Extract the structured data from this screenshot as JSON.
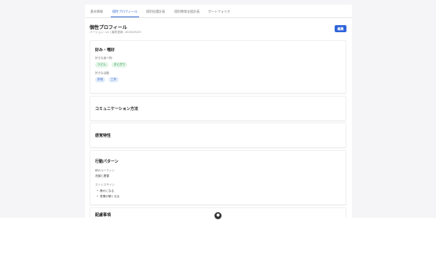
{
  "tabs": [
    {
      "label": "基本情報"
    },
    {
      "label": "個性プロフィール"
    },
    {
      "label": "個別処遇計画"
    },
    {
      "label": "個別教育支援計画"
    },
    {
      "label": "ポートフォリオ"
    }
  ],
  "page": {
    "title": "個性プロフィール",
    "subtitle": "バージョン: v2 | 最終更新: 2025/05/25",
    "edit_label": "編集"
  },
  "sections": {
    "likes": {
      "title": "好み・嗜好",
      "food_label": "好きな食べ物",
      "foods": [
        "うどん",
        "おにぎり"
      ],
      "activity_label": "好きな活動",
      "activities": [
        "折紙",
        "工作"
      ]
    },
    "communication": {
      "title": "コミュニケーション方法"
    },
    "sensory": {
      "title": "感覚特性"
    },
    "behavior": {
      "title": "行動パターン",
      "routine_label": "朝のルーティン",
      "routine_value": "洗顔と着替",
      "stress_label": "ストレスサイン",
      "stress_items": [
        "静かになる",
        "表情が硬くなる"
      ]
    },
    "notes": {
      "title": "配慮事項"
    }
  },
  "colors": {
    "accent": "#2f64d9",
    "chip_green_bg": "#e3f6e8",
    "chip_blue_bg": "#e4edfb"
  }
}
